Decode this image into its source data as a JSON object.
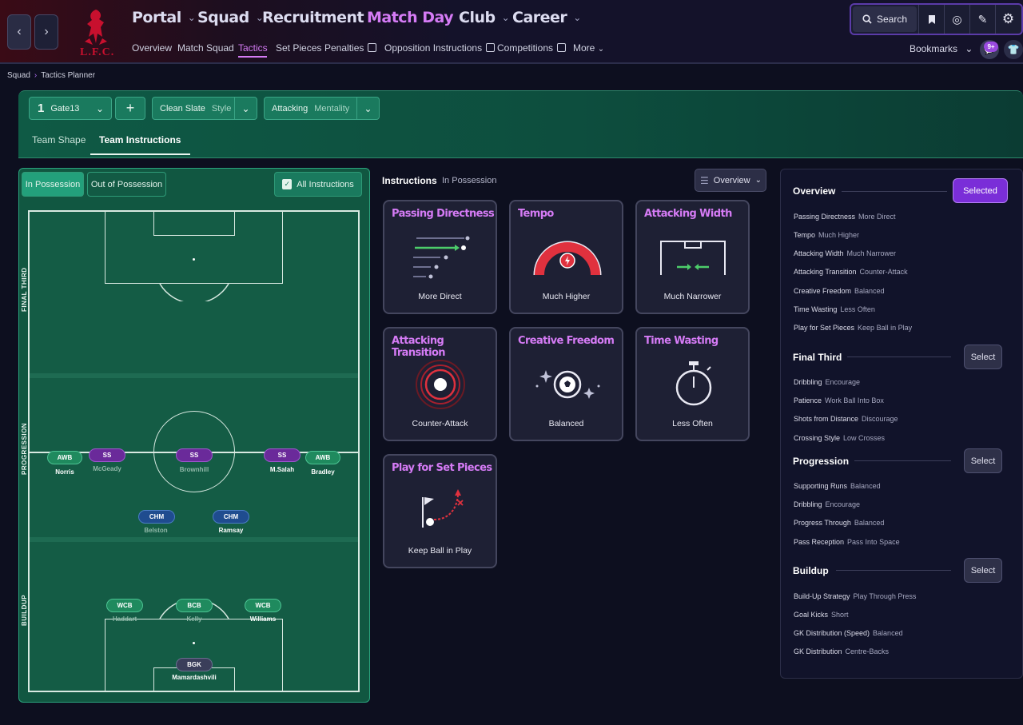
{
  "header": {
    "back_icon": "chevron-left-icon",
    "forward_icon": "chevron-right-icon",
    "club_crest_text": "L.F.C.",
    "main_nav": [
      "Portal",
      "Squad",
      "Recruitment",
      "Match Day",
      "Club",
      "Career"
    ],
    "main_nav_active": "Match Day",
    "sub_nav": [
      "Overview",
      "Match Squad",
      "Tactics",
      "Set Pieces",
      "Penalties",
      "Opposition Instructions",
      "Competitions",
      "More"
    ],
    "sub_nav_active": "Tactics",
    "search_label": "Search",
    "bookmarks_label": "Bookmarks",
    "notification_badge": "9+",
    "accent_color": "#d57bf5"
  },
  "breadcrumb": [
    "Squad",
    "Tactics Planner"
  ],
  "tactic_bar": {
    "slot_number": "1",
    "tactic_name": "Gate13",
    "add_label": "+",
    "style_value": "Clean Slate",
    "style_label": "Style",
    "mentality_value": "Attacking",
    "mentality_label": "Mentality"
  },
  "tabs": [
    "Team Shape",
    "Team Instructions"
  ],
  "tabs_active": "Team Instructions",
  "pitch": {
    "phase_buttons": [
      "In Possession",
      "Out of Possession"
    ],
    "phase_active": "In Possession",
    "all_instructions_label": "All Instructions",
    "zones": [
      "FINAL THIRD",
      "PROGRESSION",
      "BUILDUP"
    ],
    "players": [
      {
        "role": "AWB",
        "name": "Norris",
        "type": "awb",
        "dim": false
      },
      {
        "role": "SS",
        "name": "McGeady",
        "type": "ss",
        "dim": true
      },
      {
        "role": "SS",
        "name": "Brownhill",
        "type": "ss",
        "dim": true
      },
      {
        "role": "SS",
        "name": "M.Salah",
        "type": "ss",
        "dim": false
      },
      {
        "role": "AWB",
        "name": "Bradley",
        "type": "awb",
        "dim": false
      },
      {
        "role": "CHM",
        "name": "Belston",
        "type": "chm",
        "dim": true
      },
      {
        "role": "CHM",
        "name": "Ramsay",
        "type": "chm",
        "dim": false
      },
      {
        "role": "WCB",
        "name": "Haddart",
        "type": "wcb",
        "dim": true
      },
      {
        "role": "BCB",
        "name": "Kelly",
        "type": "bcb",
        "dim": true
      },
      {
        "role": "WCB",
        "name": "Williams",
        "type": "wcb",
        "dim": false
      },
      {
        "role": "BGK",
        "name": "Mamardashvili",
        "type": "bgk",
        "dim": false
      }
    ]
  },
  "instructions": {
    "title": "Instructions",
    "subtitle": "In Possession",
    "view_label": "Overview",
    "cards": [
      {
        "title": "Passing Directness",
        "value": "More Direct",
        "icon": "passing-arrows-icon"
      },
      {
        "title": "Tempo",
        "value": "Much Higher",
        "icon": "tempo-gauge-icon"
      },
      {
        "title": "Attacking Width",
        "value": "Much Narrower",
        "icon": "goal-width-icon"
      },
      {
        "title": "Attacking Transition",
        "value": "Counter-Attack",
        "icon": "target-rings-icon"
      },
      {
        "title": "Creative Freedom",
        "value": "Balanced",
        "icon": "sparkle-ball-icon"
      },
      {
        "title": "Time Wasting",
        "value": "Less Often",
        "icon": "stopwatch-icon"
      },
      {
        "title": "Play for Set Pieces",
        "value": "Keep Ball in Play",
        "icon": "corner-flag-icon"
      }
    ]
  },
  "overview": {
    "title": "Overview",
    "selected_label": "Selected",
    "select_label": "Select",
    "general": [
      {
        "k": "Passing Directness",
        "v": "More Direct"
      },
      {
        "k": "Tempo",
        "v": "Much Higher"
      },
      {
        "k": "Attacking Width",
        "v": "Much Narrower"
      },
      {
        "k": "Attacking Transition",
        "v": "Counter-Attack"
      },
      {
        "k": "Creative Freedom",
        "v": "Balanced"
      },
      {
        "k": "Time Wasting",
        "v": "Less Often"
      },
      {
        "k": "Play for Set Pieces",
        "v": "Keep Ball in Play"
      }
    ],
    "sections": [
      {
        "title": "Final Third",
        "items": [
          {
            "k": "Dribbling",
            "v": "Encourage"
          },
          {
            "k": "Patience",
            "v": "Work Ball Into Box"
          },
          {
            "k": "Shots from Distance",
            "v": "Discourage"
          },
          {
            "k": "Crossing Style",
            "v": "Low Crosses"
          }
        ]
      },
      {
        "title": "Progression",
        "items": [
          {
            "k": "Supporting Runs",
            "v": "Balanced"
          },
          {
            "k": "Dribbling",
            "v": "Encourage"
          },
          {
            "k": "Progress Through",
            "v": "Balanced"
          },
          {
            "k": "Pass Reception",
            "v": "Pass Into Space"
          }
        ]
      },
      {
        "title": "Buildup",
        "items": [
          {
            "k": "Build-Up Strategy",
            "v": "Play Through Press"
          },
          {
            "k": "Goal Kicks",
            "v": "Short"
          },
          {
            "k": "GK Distribution (Speed)",
            "v": "Balanced"
          },
          {
            "k": "GK Distribution",
            "v": "Centre-Backs"
          }
        ]
      }
    ]
  }
}
